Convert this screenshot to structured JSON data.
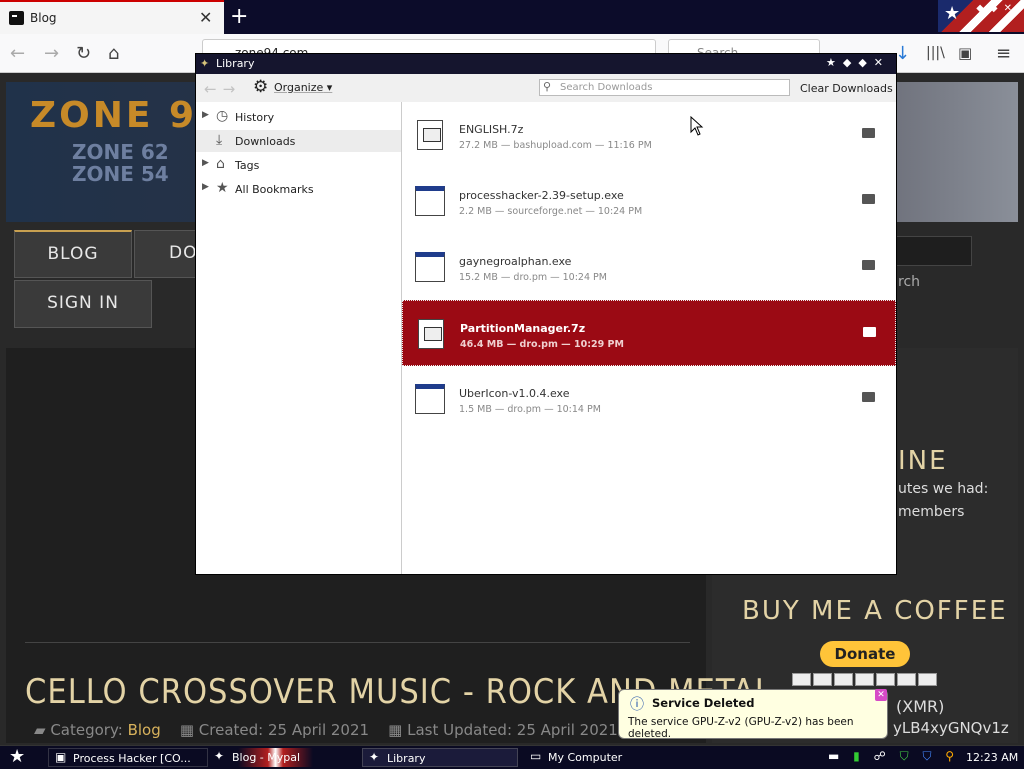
{
  "browser": {
    "tab_title": "Blog",
    "url": "zone94.com",
    "search_placeholder": "Search"
  },
  "site": {
    "logo_main": "ZONE 9",
    "logo_sub1": "ZONE 62",
    "logo_sub2": "ZONE 54",
    "nav": [
      "BLOG",
      "DO",
      "SIGN IN"
    ],
    "search_hint": "rch",
    "sidebar_heading": "INE",
    "sidebar_text1": "utes we had:",
    "sidebar_text2": "members",
    "coffee_heading": "BUY ME A COFFEE",
    "donate_label": "Donate",
    "crypto_label": "(XMR)",
    "crypto_addr": "yLB4xyGNQv1z",
    "post_title": "CELLO CROSSOVER MUSIC - ROCK AND METAL",
    "post_category_label": "Category:",
    "post_category": "Blog",
    "post_created": "Created: 25 April 2021",
    "post_updated": "Last Updated: 25 April 2021"
  },
  "library": {
    "title": "Library",
    "organize_label": "Organize",
    "search_placeholder": "Search Downloads",
    "clear_label": "Clear Downloads",
    "tree": [
      {
        "label": "History",
        "icon": "clock-icon",
        "expandable": true
      },
      {
        "label": "Downloads",
        "icon": "download-icon",
        "expandable": false,
        "selected": true
      },
      {
        "label": "Tags",
        "icon": "tag-icon",
        "expandable": true
      },
      {
        "label": "All Bookmarks",
        "icon": "star-icon",
        "expandable": true
      }
    ],
    "downloads": [
      {
        "name": "ENGLISH.7z",
        "meta": "27.2 MB — bashupload.com — 11:16 PM",
        "type": "archive"
      },
      {
        "name": "processhacker-2.39-setup.exe",
        "meta": "2.2 MB — sourceforge.net — 10:24 PM",
        "type": "exe"
      },
      {
        "name": "gaynegroalphan.exe",
        "meta": "15.2 MB — dro.pm — 10:24 PM",
        "type": "exe"
      },
      {
        "name": "PartitionManager.7z",
        "meta": "46.4 MB — dro.pm — 10:29 PM",
        "type": "archive",
        "selected": true
      },
      {
        "name": "UberIcon-v1.0.4.exe",
        "meta": "1.5 MB — dro.pm — 10:14 PM",
        "type": "exe"
      }
    ]
  },
  "notification": {
    "title": "Service Deleted",
    "message": "The service GPU-Z-v2 (GPU-Z-v2) has been deleted."
  },
  "taskbar": {
    "items": [
      "Process Hacker [CO...",
      "Blog - Mypal",
      "Library",
      "My Computer"
    ],
    "clock": "12:23 AM"
  },
  "colors": {
    "selection": "#9b0a14",
    "title_bar": "#15152e",
    "accent_gold": "#e3d3a6"
  }
}
